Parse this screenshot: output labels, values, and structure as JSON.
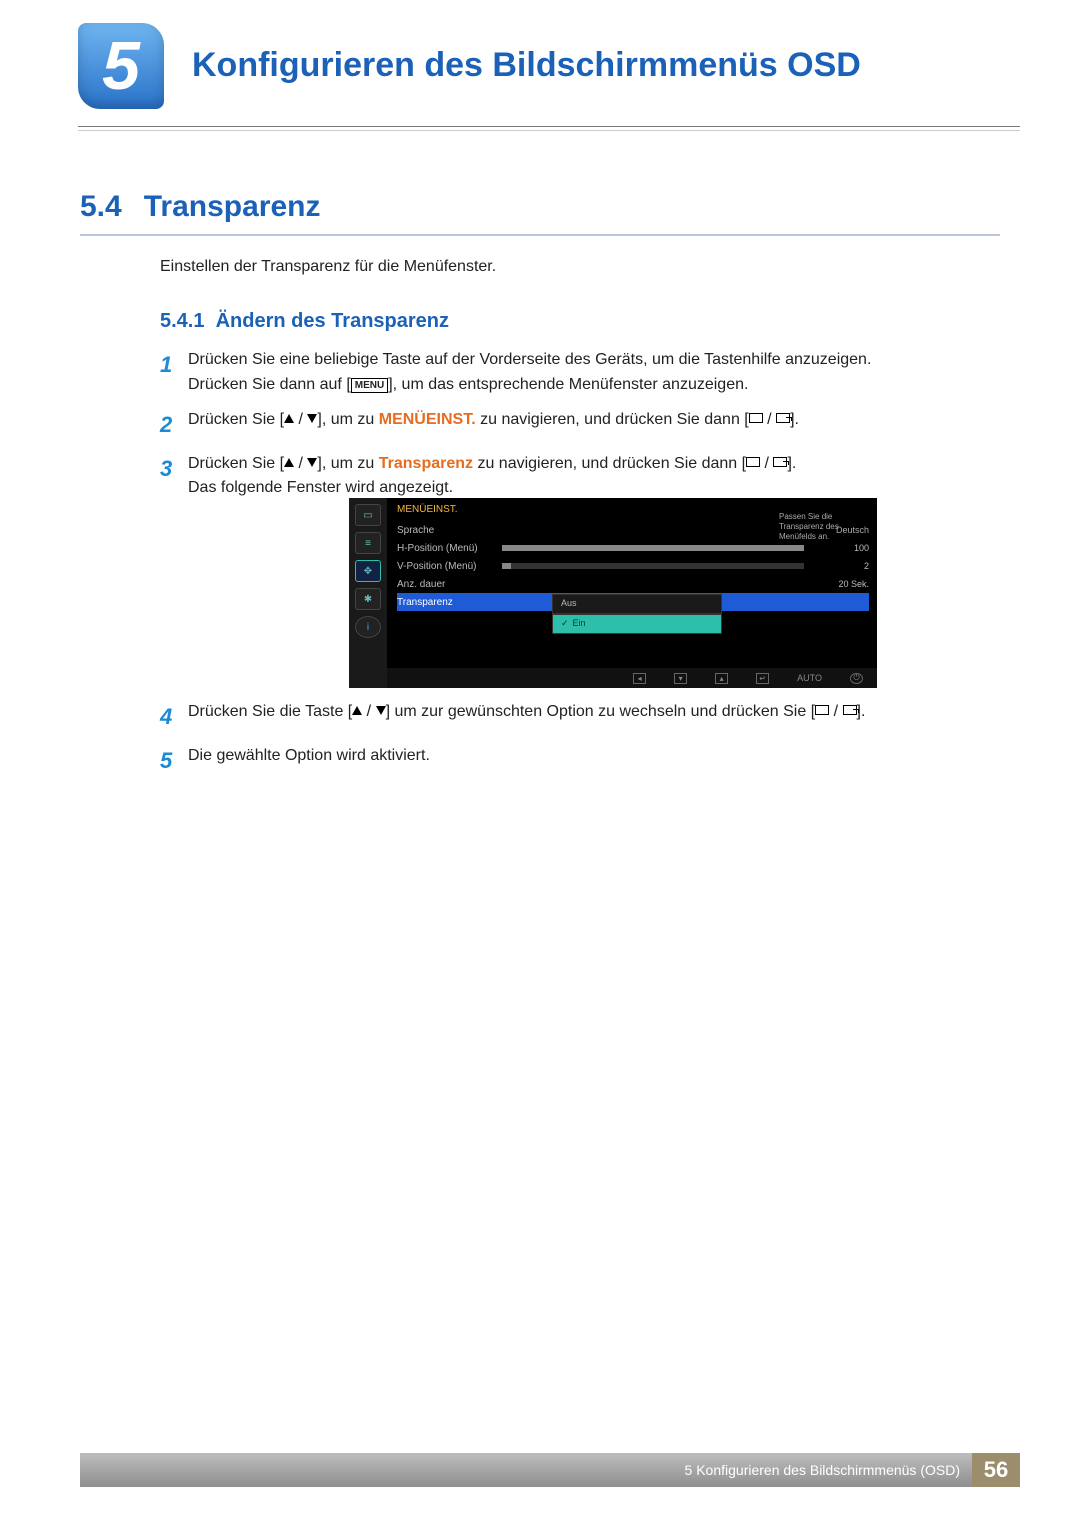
{
  "chapter": {
    "number": "5",
    "title": "Konfigurieren des Bildschirmmenüs OSD"
  },
  "section": {
    "number": "5.4",
    "title": "Transparenz",
    "intro": "Einstellen der Transparenz für die Menüfenster."
  },
  "subsection": {
    "number": "5.4.1",
    "title": "Ändern des Transparenz"
  },
  "steps": {
    "s1a": "Drücken Sie eine beliebige Taste auf der Vorderseite des Geräts, um die Tastenhilfe anzuzeigen.",
    "s1b_pre": "Drücken Sie dann auf [",
    "s1b_key": "MENU",
    "s1b_post": "], um das entsprechende Menüfenster anzuzeigen.",
    "s2_pre": "Drücken Sie [",
    "s2_mid": "], um zu ",
    "s2_tgt": "MENÜEINST.",
    "s2_post": " zu navigieren, und drücken Sie dann [",
    "s2_end": "].",
    "s3_pre": "Drücken Sie [",
    "s3_mid": "], um zu ",
    "s3_tgt": "Transparenz",
    "s3_post": " zu navigieren, und drücken Sie dann [",
    "s3_end": "].",
    "s3_note": "Das folgende Fenster wird angezeigt.",
    "s4_pre": "Drücken Sie die Taste [",
    "s4_mid": "] um zur gewünschten Option zu wechseln und drücken Sie [",
    "s4_end": "].",
    "s5": "Die gewählte Option wird aktiviert."
  },
  "osd": {
    "title": "MENÜEINST.",
    "rows": {
      "lang": {
        "label": "Sprache",
        "value": "Deutsch"
      },
      "hpos": {
        "label": "H-Position (Menü)",
        "value": "100",
        "fill": 100
      },
      "vpos": {
        "label": "V-Position (Menü)",
        "value": "2",
        "fill": 3
      },
      "dur": {
        "label": "Anz. dauer",
        "value": "20 Sek."
      },
      "trans": {
        "label": "Transparenz"
      }
    },
    "options": {
      "off": "Aus",
      "on": "Ein"
    },
    "tooltip": "Passen Sie die Transparenz des Menüfelds an.",
    "footer_auto": "AUTO"
  },
  "footer": {
    "label": "5 Konfigurieren des Bildschirmmenüs (OSD)",
    "page": "56"
  }
}
